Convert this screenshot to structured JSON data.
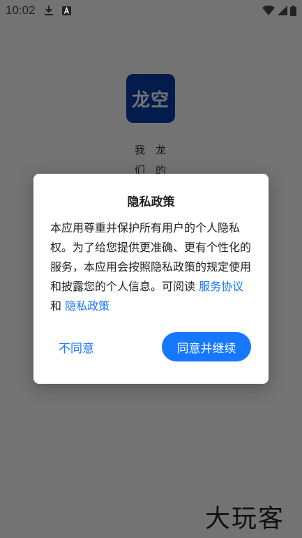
{
  "status_bar": {
    "time": "10:02",
    "icons": [
      "download-icon",
      "a-notification-icon",
      "wifi-icon",
      "signal-icon",
      "battery-icon"
    ]
  },
  "splash": {
    "logo_text": "龙空",
    "left_column": [
      "我",
      "们"
    ],
    "right_column": [
      "龙",
      "的"
    ]
  },
  "dialog": {
    "title": "隐私政策",
    "body_text": "本应用尊重并保护所有用户的个人隐私权。为了给您提供更准确、更有个性化的服务，本应用会按照隐私政策的规定使用和披露您的个人信息。可阅读",
    "link_service": "服务协议",
    "and_text": "和",
    "link_privacy": "隐私政策",
    "disagree_label": "不同意",
    "agree_label": "同意并继续"
  },
  "colors": {
    "accent": "#1677ff",
    "logo_bg": "#0b3ea8",
    "overlay": "rgba(0,0,0,0.55)"
  },
  "watermark": "大玩客"
}
